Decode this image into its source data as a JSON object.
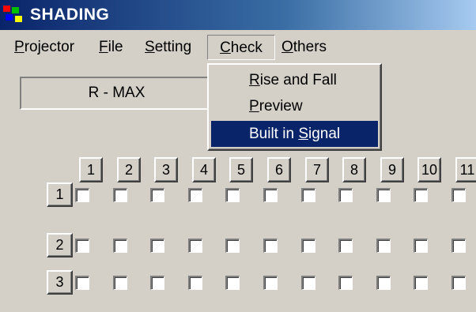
{
  "window": {
    "title": "SHADING"
  },
  "menu": [
    {
      "id": "projector",
      "label": "Projector",
      "accel": "P",
      "rest": "rojector"
    },
    {
      "id": "file",
      "label": "File",
      "accel": "F",
      "rest": "ile"
    },
    {
      "id": "setting",
      "label": "Setting",
      "accel": "S",
      "rest": "etting"
    },
    {
      "id": "check",
      "label": "Check",
      "accel": "C",
      "rest": "heck",
      "open": true
    },
    {
      "id": "others",
      "label": "Others",
      "accel": "O",
      "rest": "thers"
    }
  ],
  "indicator": {
    "text": "R - MAX"
  },
  "check_menu": {
    "items": [
      {
        "label": "Rise and Fall",
        "pre": "",
        "accel": "R",
        "post": "ise and Fall",
        "selected": false
      },
      {
        "label": "Preview",
        "pre": "",
        "accel": "P",
        "post": "review",
        "selected": false
      },
      {
        "label": "Built in Signal",
        "pre": "Built in ",
        "accel": "S",
        "post": "ignal",
        "selected": true
      }
    ]
  },
  "grid": {
    "columns": [
      "1",
      "2",
      "3",
      "4",
      "5",
      "6",
      "7",
      "8",
      "9",
      "10",
      "11"
    ],
    "rows": [
      "1",
      "2",
      "3"
    ],
    "checked": false
  },
  "colors": {
    "window_bg": "#d4d0c8",
    "title_start": "#0a246a",
    "title_end": "#a6caf0",
    "highlight": "#0a246a"
  }
}
